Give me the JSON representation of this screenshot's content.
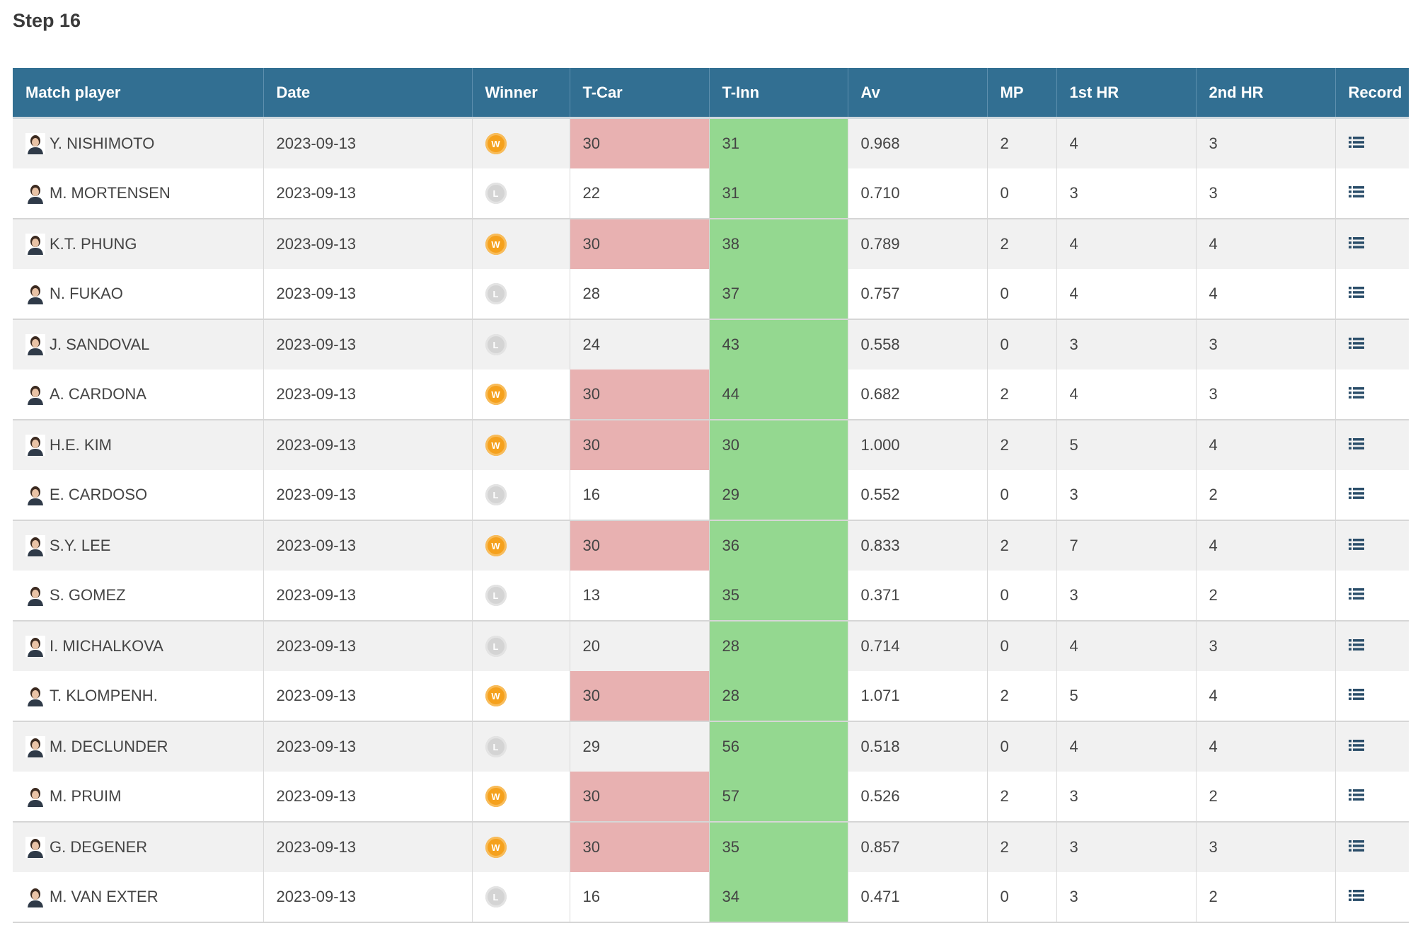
{
  "step_title": "Step 16",
  "columns": [
    "Match player",
    "Date",
    "Winner",
    "T-Car",
    "T-Inn",
    "Av",
    "MP",
    "1st HR",
    "2nd HR",
    "Record"
  ],
  "colors": {
    "header_bg": "#326f92",
    "tcar_highlight": "#e8b1b1",
    "tinn_bg": "#94d890",
    "win_badge": "#f5a11d",
    "loss_badge": "#d4d4d4"
  },
  "rows": [
    {
      "player": "Y. NISHIMOTO",
      "date": "2023-09-13",
      "winner": "W",
      "tcar": "30",
      "tinn": "31",
      "av": "0.968",
      "mp": "2",
      "hr1": "4",
      "hr2": "3",
      "record_icon": "list-icon"
    },
    {
      "player": "M. MORTENSEN",
      "date": "2023-09-13",
      "winner": "L",
      "tcar": "22",
      "tinn": "31",
      "av": "0.710",
      "mp": "0",
      "hr1": "3",
      "hr2": "3",
      "record_icon": "list-icon"
    },
    {
      "player": "K.T. PHUNG",
      "date": "2023-09-13",
      "winner": "W",
      "tcar": "30",
      "tinn": "38",
      "av": "0.789",
      "mp": "2",
      "hr1": "4",
      "hr2": "4",
      "record_icon": "list-icon"
    },
    {
      "player": "N. FUKAO",
      "date": "2023-09-13",
      "winner": "L",
      "tcar": "28",
      "tinn": "37",
      "av": "0.757",
      "mp": "0",
      "hr1": "4",
      "hr2": "4",
      "record_icon": "list-icon"
    },
    {
      "player": "J. SANDOVAL",
      "date": "2023-09-13",
      "winner": "L",
      "tcar": "24",
      "tinn": "43",
      "av": "0.558",
      "mp": "0",
      "hr1": "3",
      "hr2": "3",
      "record_icon": "list-icon"
    },
    {
      "player": "A. CARDONA",
      "date": "2023-09-13",
      "winner": "W",
      "tcar": "30",
      "tinn": "44",
      "av": "0.682",
      "mp": "2",
      "hr1": "4",
      "hr2": "3",
      "record_icon": "list-icon"
    },
    {
      "player": "H.E. KIM",
      "date": "2023-09-13",
      "winner": "W",
      "tcar": "30",
      "tinn": "30",
      "av": "1.000",
      "mp": "2",
      "hr1": "5",
      "hr2": "4",
      "record_icon": "list-icon"
    },
    {
      "player": "E. CARDOSO",
      "date": "2023-09-13",
      "winner": "L",
      "tcar": "16",
      "tinn": "29",
      "av": "0.552",
      "mp": "0",
      "hr1": "3",
      "hr2": "2",
      "record_icon": "list-icon"
    },
    {
      "player": "S.Y. LEE",
      "date": "2023-09-13",
      "winner": "W",
      "tcar": "30",
      "tinn": "36",
      "av": "0.833",
      "mp": "2",
      "hr1": "7",
      "hr2": "4",
      "record_icon": "list-icon"
    },
    {
      "player": "S. GOMEZ",
      "date": "2023-09-13",
      "winner": "L",
      "tcar": "13",
      "tinn": "35",
      "av": "0.371",
      "mp": "0",
      "hr1": "3",
      "hr2": "2",
      "record_icon": "list-icon"
    },
    {
      "player": "I. MICHALKOVA",
      "date": "2023-09-13",
      "winner": "L",
      "tcar": "20",
      "tinn": "28",
      "av": "0.714",
      "mp": "0",
      "hr1": "4",
      "hr2": "3",
      "record_icon": "list-icon"
    },
    {
      "player": "T. KLOMPENH.",
      "date": "2023-09-13",
      "winner": "W",
      "tcar": "30",
      "tinn": "28",
      "av": "1.071",
      "mp": "2",
      "hr1": "5",
      "hr2": "4",
      "record_icon": "list-icon"
    },
    {
      "player": "M. DECLUNDER",
      "date": "2023-09-13",
      "winner": "L",
      "tcar": "29",
      "tinn": "56",
      "av": "0.518",
      "mp": "0",
      "hr1": "4",
      "hr2": "4",
      "record_icon": "list-icon"
    },
    {
      "player": "M. PRUIM",
      "date": "2023-09-13",
      "winner": "W",
      "tcar": "30",
      "tinn": "57",
      "av": "0.526",
      "mp": "2",
      "hr1": "3",
      "hr2": "2",
      "record_icon": "list-icon"
    },
    {
      "player": "G. DEGENER",
      "date": "2023-09-13",
      "winner": "W",
      "tcar": "30",
      "tinn": "35",
      "av": "0.857",
      "mp": "2",
      "hr1": "3",
      "hr2": "3",
      "record_icon": "list-icon"
    },
    {
      "player": "M. VAN EXTER",
      "date": "2023-09-13",
      "winner": "L",
      "tcar": "16",
      "tinn": "34",
      "av": "0.471",
      "mp": "0",
      "hr1": "3",
      "hr2": "2",
      "record_icon": "list-icon"
    }
  ]
}
